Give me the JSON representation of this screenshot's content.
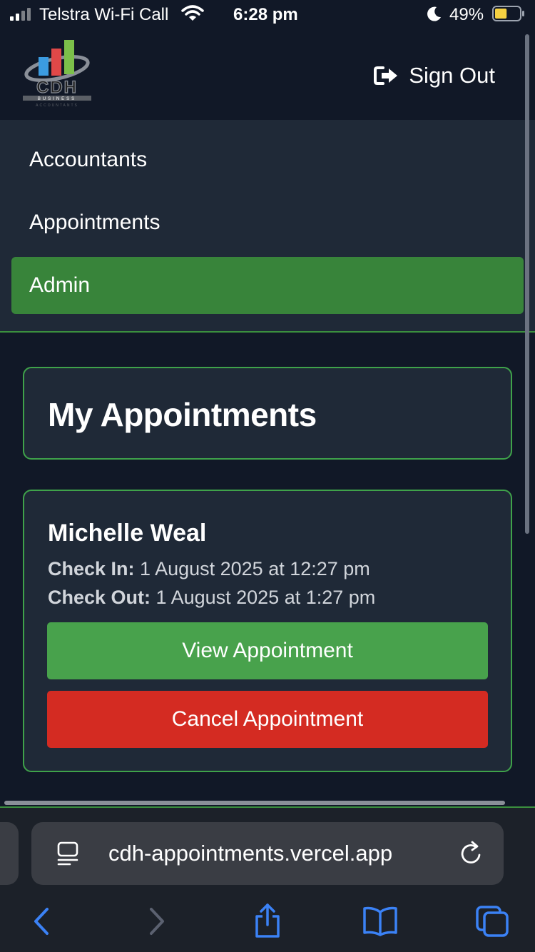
{
  "status_bar": {
    "carrier": "Telstra Wi-Fi Call",
    "time": "6:28 pm",
    "battery_percent": "49%",
    "battery_level": 0.49
  },
  "header": {
    "logo": {
      "text": "CDH",
      "sub_text_1": "BUSINESS",
      "sub_text_2": "ACCOUNTANTS"
    },
    "sign_out_label": "Sign Out"
  },
  "nav": {
    "items": [
      {
        "label": "Accountants",
        "active": false
      },
      {
        "label": "Appointments",
        "active": false
      },
      {
        "label": "Admin",
        "active": true
      }
    ]
  },
  "main": {
    "title": "My Appointments",
    "appointments": [
      {
        "name": "Michelle Weal",
        "check_in_label": "Check In:",
        "check_in_value": "1 August 2025 at 12:27 pm",
        "check_out_label": "Check Out:",
        "check_out_value": "1 August 2025 at 1:27 pm",
        "view_label": "View Appointment",
        "cancel_label": "Cancel Appointment"
      }
    ]
  },
  "browser": {
    "url": "cdh-appointments.vercel.app",
    "icons": [
      "page-menu-icon",
      "reload-icon",
      "back-icon",
      "forward-icon",
      "share-icon",
      "bookmarks-icon",
      "tabs-icon"
    ]
  },
  "colors": {
    "background": "#111827",
    "nav_background": "#1f2937",
    "accent_green": "#48a24c",
    "active_nav": "#38843a",
    "danger_red": "#d42b22",
    "border_green": "#3fa24a",
    "browser_blue": "#3b82f6"
  }
}
